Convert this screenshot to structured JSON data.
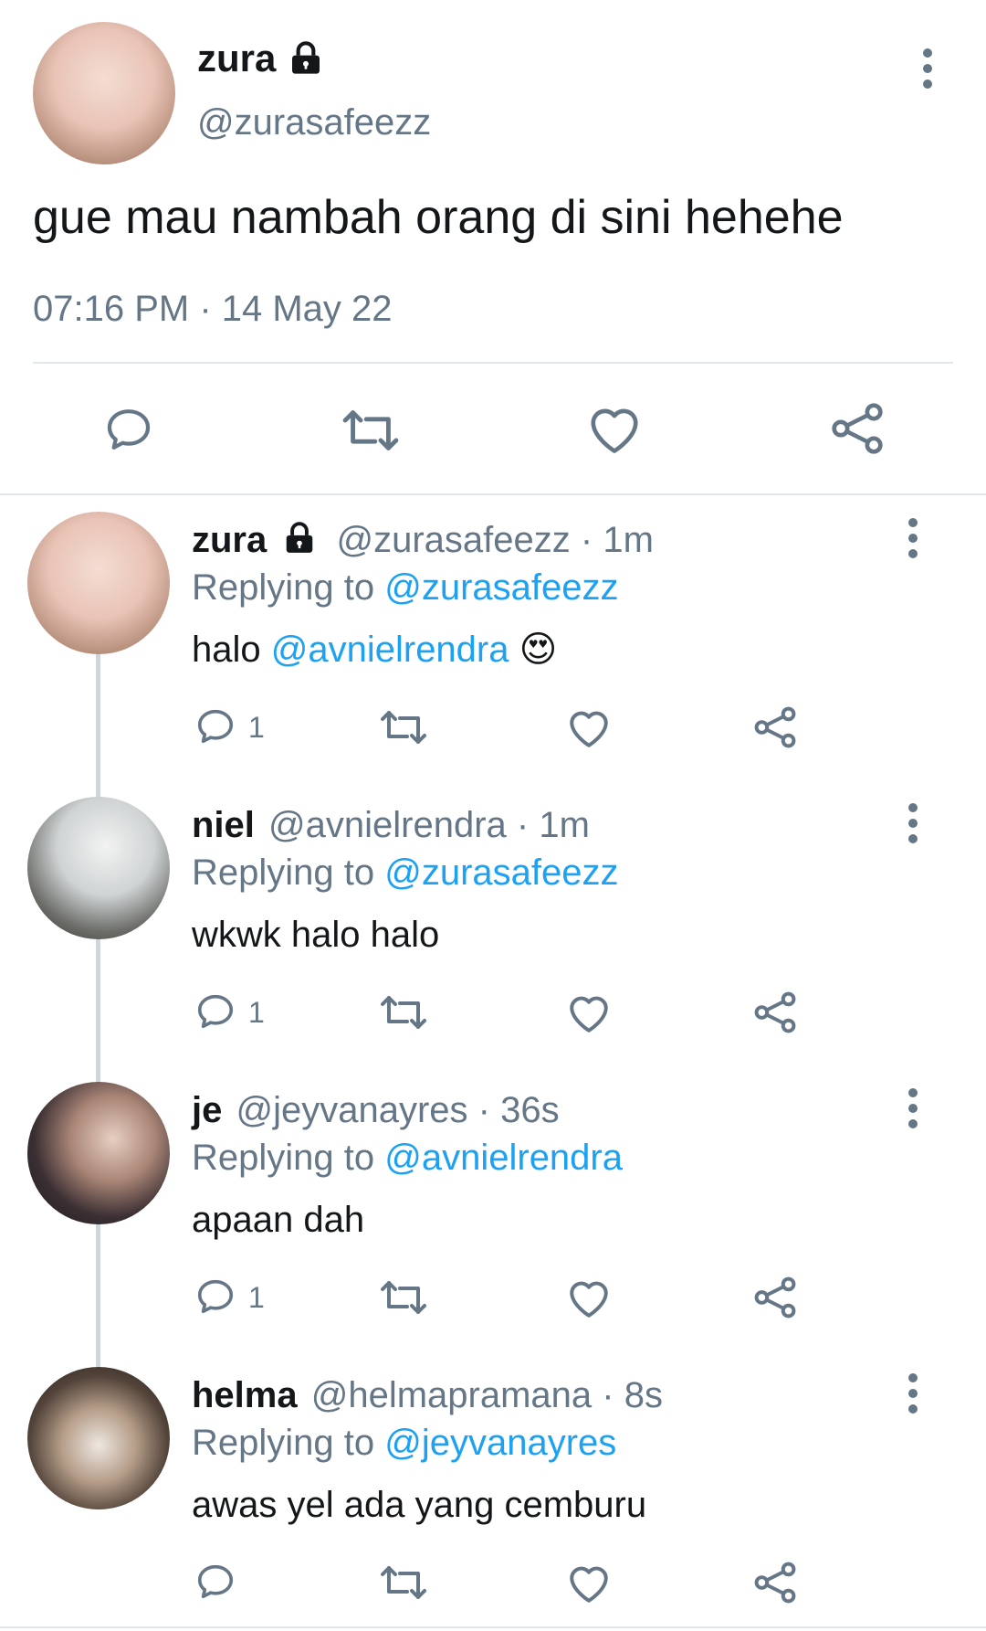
{
  "main_tweet": {
    "display_name": "zura",
    "handle": "@zurasafeezz",
    "text": "gue mau nambah orang di sini hehehe",
    "timestamp": "07:16 PM · 14 May 22",
    "locked": true
  },
  "replies": [
    {
      "display_name": "zura",
      "handle": "@zurasafeezz",
      "time": "· 1m",
      "replying_label": "Replying to",
      "replying_to": "@zurasafeezz",
      "text_prefix": "halo ",
      "mention": "@avnielrendra",
      "emoji": "😍",
      "reply_count": "1",
      "locked": true
    },
    {
      "display_name": "niel",
      "handle": "@avnielrendra",
      "time": "· 1m",
      "replying_label": "Replying to",
      "replying_to": "@zurasafeezz",
      "text": "wkwk halo halo",
      "reply_count": "1"
    },
    {
      "display_name": "je",
      "handle": "@jeyvanayres",
      "time": "· 36s",
      "replying_label": "Replying to",
      "replying_to": "@avnielrendra",
      "text": "apaan dah",
      "reply_count": "1"
    },
    {
      "display_name": "helma",
      "handle": "@helmapramana",
      "time": "· 8s",
      "replying_label": "Replying to",
      "replying_to": "@jeyvanayres",
      "text": "awas yel ada yang cemburu",
      "reply_count": ""
    }
  ],
  "icons": {
    "reply": "reply-icon",
    "retweet": "retweet-icon",
    "like": "like-icon",
    "share": "share-icon",
    "more": "more-vertical-icon",
    "lock": "lock-icon"
  },
  "colors": {
    "link": "#1da1f2",
    "muted": "#657786",
    "text": "#14171a",
    "divider": "#e1e8ed",
    "thread_line": "#ccd6dd"
  }
}
